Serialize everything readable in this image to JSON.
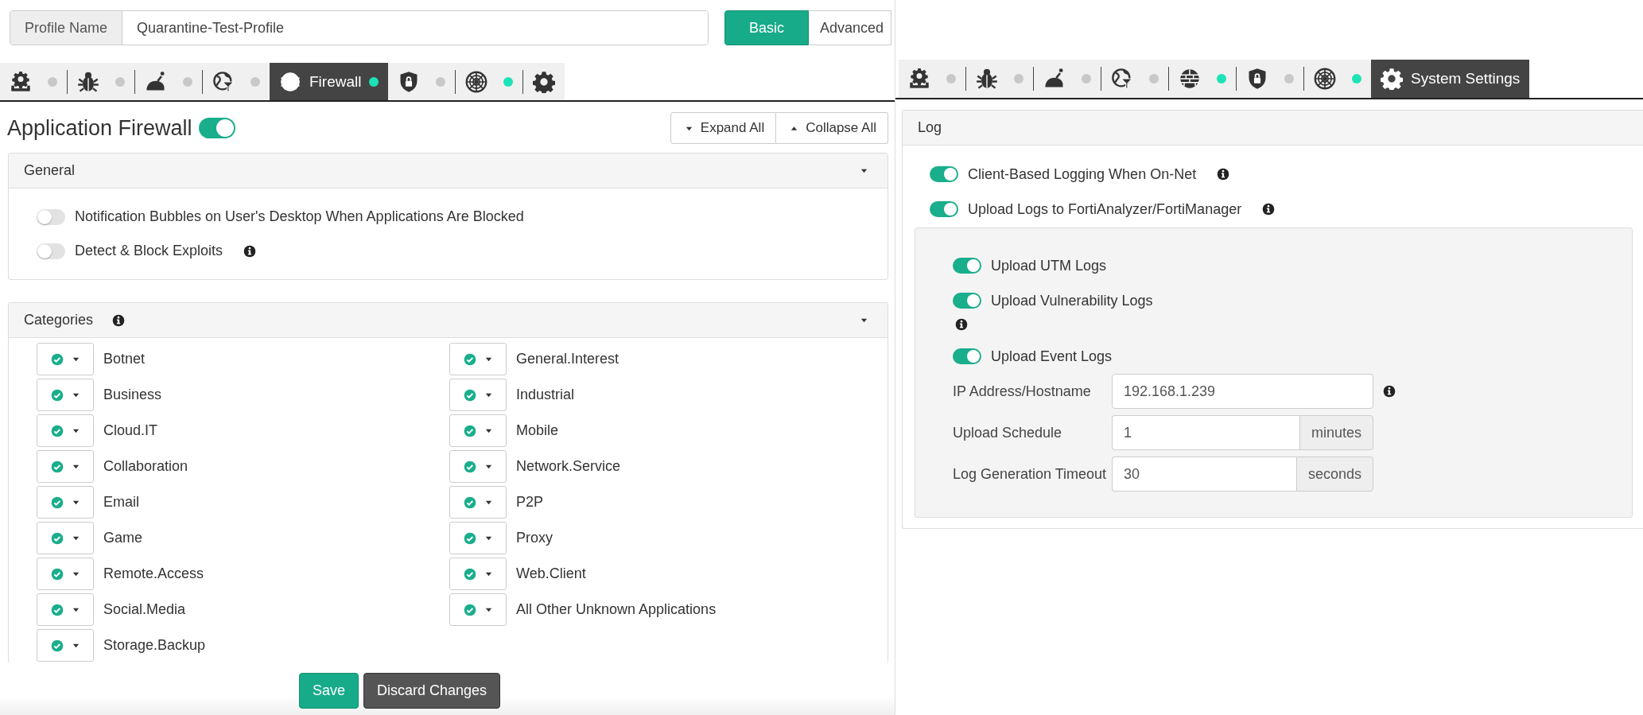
{
  "left": {
    "profile": {
      "label": "Profile Name",
      "value": "Quarantine-Test-Profile"
    },
    "modes": [
      {
        "label": "Basic",
        "selected": true
      },
      {
        "label": "Advanced",
        "selected": false
      }
    ],
    "tabs": [
      {
        "selected": false,
        "active": false
      },
      {
        "selected": false,
        "active": false
      },
      {
        "selected": false,
        "active": false
      },
      {
        "selected": false,
        "active": false
      },
      {
        "label": "Firewall",
        "selected": true,
        "active": true
      },
      {
        "selected": false,
        "active": false
      },
      {
        "selected": false,
        "active": true
      },
      {
        "selected": false
      }
    ],
    "heading": {
      "title": "Application Firewall",
      "on": true
    },
    "expand_buttons": [
      "Expand All",
      "Collapse All"
    ],
    "general": {
      "title": "General",
      "items": [
        {
          "label": "Notification Bubbles on User's Desktop When Applications Are Blocked",
          "on": false,
          "info": false
        },
        {
          "label": "Detect & Block Exploits",
          "on": false,
          "info": true
        }
      ]
    },
    "categories": {
      "title": "Categories",
      "columns": [
        [
          {
            "label": "Botnet",
            "checked": true
          },
          {
            "label": "Business",
            "checked": true
          },
          {
            "label": "Cloud.IT",
            "checked": true
          },
          {
            "label": "Collaboration",
            "checked": true
          },
          {
            "label": "Email",
            "checked": true
          },
          {
            "label": "Game",
            "checked": true
          },
          {
            "label": "Remote.Access",
            "checked": true
          },
          {
            "label": "Social.Media",
            "checked": true
          },
          {
            "label": "Storage.Backup",
            "checked": true
          }
        ],
        [
          {
            "label": "General.Interest",
            "checked": true
          },
          {
            "label": "Industrial",
            "checked": true
          },
          {
            "label": "Mobile",
            "checked": true
          },
          {
            "label": "Network.Service",
            "checked": true
          },
          {
            "label": "P2P",
            "checked": true
          },
          {
            "label": "Proxy",
            "checked": true
          },
          {
            "label": "Web.Client",
            "checked": true
          },
          {
            "label": "All Other Unknown Applications",
            "checked": true
          }
        ]
      ]
    },
    "footer_buttons": [
      {
        "label": "Save",
        "kind": "primary"
      },
      {
        "label": "Discard Changes",
        "kind": "dark"
      }
    ]
  },
  "right": {
    "tabs": [
      {
        "selected": false,
        "active": false
      },
      {
        "selected": false,
        "active": false
      },
      {
        "selected": false,
        "active": false
      },
      {
        "selected": false,
        "active": false
      },
      {
        "selected": false,
        "active": true
      },
      {
        "selected": false,
        "active": false
      },
      {
        "selected": false,
        "active": true
      },
      {
        "label": "System Settings",
        "selected": true
      }
    ],
    "log": {
      "title": "Log",
      "toggles": [
        {
          "label": "Client-Based Logging When On-Net",
          "on": true,
          "info": true
        },
        {
          "label": "Upload Logs to FortiAnalyzer/FortiManager",
          "on": true,
          "info": true
        }
      ],
      "upload": {
        "toggles": [
          {
            "label": "Upload UTM Logs",
            "on": true,
            "info": false
          },
          {
            "label": "Upload Vulnerability Logs",
            "on": true,
            "info": true
          },
          {
            "label": "Upload Event Logs",
            "on": true,
            "info": false
          }
        ],
        "fields": [
          {
            "label": "IP Address/Hostname",
            "value": "192.168.1.239",
            "info": true
          },
          {
            "label": "Upload Schedule",
            "value": "1",
            "unit": "minutes",
            "info": false
          },
          {
            "label": "Log Generation Timeout",
            "value": "30",
            "unit": "seconds",
            "info": false
          }
        ]
      }
    }
  }
}
